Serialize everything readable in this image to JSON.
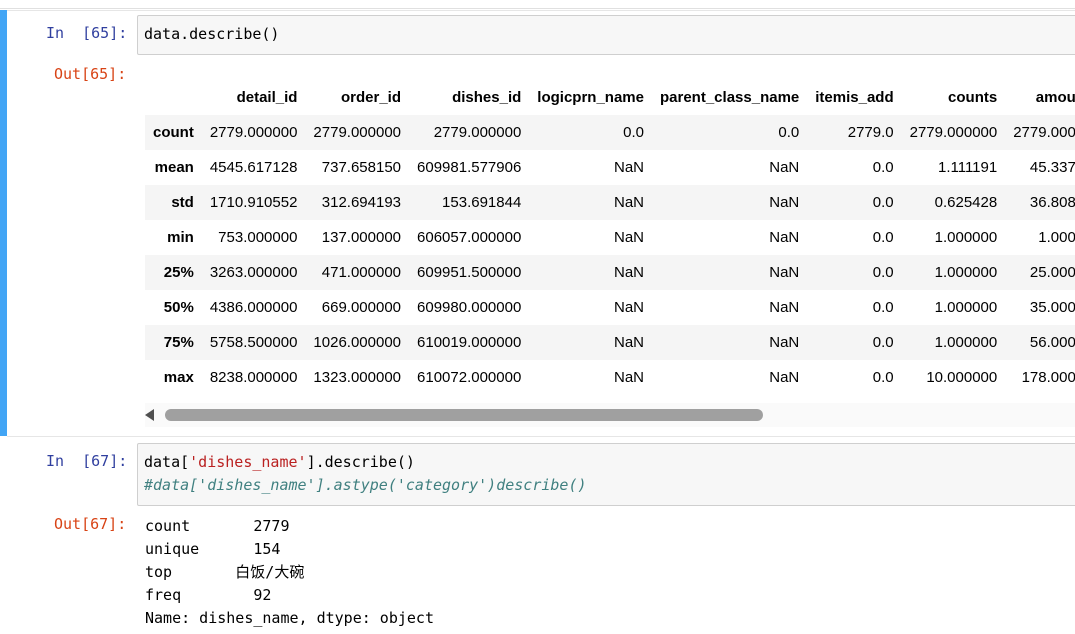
{
  "cell1": {
    "in_prompt": "In  [65]:",
    "code": "data.describe()",
    "out_prompt": "Out[65]:",
    "table": {
      "columns": [
        "",
        "detail_id",
        "order_id",
        "dishes_id",
        "logicprn_name",
        "parent_class_name",
        "itemis_add",
        "counts",
        "amou"
      ],
      "rows": [
        [
          "count",
          "2779.000000",
          "2779.000000",
          "2779.000000",
          "0.0",
          "0.0",
          "2779.0",
          "2779.000000",
          "2779.000"
        ],
        [
          "mean",
          "4545.617128",
          "737.658150",
          "609981.577906",
          "NaN",
          "NaN",
          "0.0",
          "1.111191",
          "45.337"
        ],
        [
          "std",
          "1710.910552",
          "312.694193",
          "153.691844",
          "NaN",
          "NaN",
          "0.0",
          "0.625428",
          "36.808"
        ],
        [
          "min",
          "753.000000",
          "137.000000",
          "606057.000000",
          "NaN",
          "NaN",
          "0.0",
          "1.000000",
          "1.000"
        ],
        [
          "25%",
          "3263.000000",
          "471.000000",
          "609951.500000",
          "NaN",
          "NaN",
          "0.0",
          "1.000000",
          "25.000"
        ],
        [
          "50%",
          "4386.000000",
          "669.000000",
          "609980.000000",
          "NaN",
          "NaN",
          "0.0",
          "1.000000",
          "35.000"
        ],
        [
          "75%",
          "5758.500000",
          "1026.000000",
          "610019.000000",
          "NaN",
          "NaN",
          "0.0",
          "1.000000",
          "56.000"
        ],
        [
          "max",
          "8238.000000",
          "1323.000000",
          "610072.000000",
          "NaN",
          "NaN",
          "0.0",
          "10.000000",
          "178.000"
        ]
      ]
    }
  },
  "cell2": {
    "in_prompt": "In  [67]:",
    "code_line1_pre": "data[",
    "code_line1_str": "'dishes_name'",
    "code_line1_post": "].describe()",
    "code_line2": "#data['dishes_name'].astype('category')describe()",
    "out_prompt": "Out[67]:",
    "output_lines": [
      "count       2779",
      "unique      154",
      "top       白饭/大碗",
      "freq        92",
      "Name: dishes_name, dtype: object"
    ]
  }
}
